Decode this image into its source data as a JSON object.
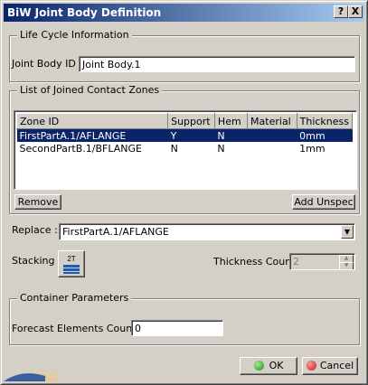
{
  "window": {
    "title": "BiW Joint Body Definition",
    "help_label": "?",
    "close_label": "X"
  },
  "lifecycle": {
    "group_label": "Life Cycle Information",
    "joint_body_id_label": "Joint Body ID :",
    "joint_body_id_value": "Joint Body.1"
  },
  "contact_zones": {
    "group_label": "List of Joined Contact Zones",
    "columns": [
      "Zone ID",
      "Support",
      "Hem",
      "Material",
      "Thickness"
    ],
    "rows": [
      {
        "zone_id": "FirstPartA.1/AFLANGE",
        "support": "Y",
        "hem": "N",
        "material": "",
        "thickness": "0mm",
        "selected": true
      },
      {
        "zone_id": "SecondPartB.1/BFLANGE",
        "support": "N",
        "hem": "N",
        "material": "",
        "thickness": "1mm",
        "selected": false
      }
    ],
    "remove_label": "Remove",
    "add_unspec_label": "Add Unspec"
  },
  "replace": {
    "label": "Replace :",
    "value": "FirstPartA.1/AFLANGE"
  },
  "stacking": {
    "label": "Stacking :",
    "icon_text": "2T"
  },
  "thickness_count": {
    "label": "Thickness Count:",
    "value": "2"
  },
  "container": {
    "group_label": "Container Parameters",
    "forecast_label": "Forecast Elements Count :",
    "forecast_value": "0"
  },
  "footer": {
    "ok_label": "OK",
    "cancel_label": "Cancel"
  }
}
